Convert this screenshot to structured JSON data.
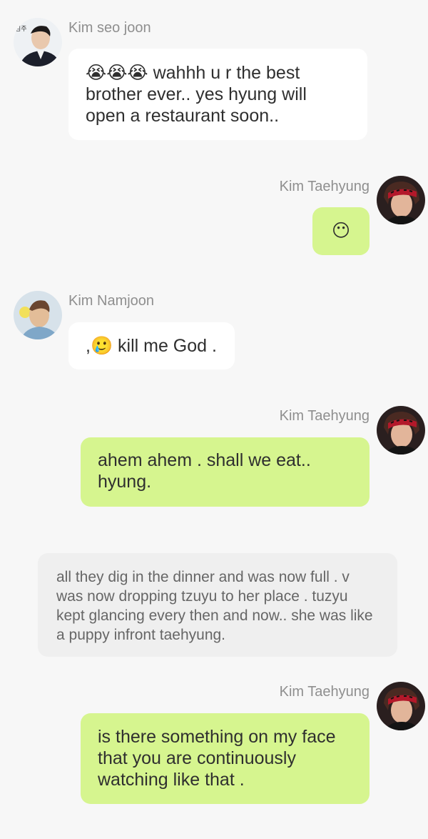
{
  "messages": [
    {
      "sender": "Kim seo joon",
      "text": "😭😭😭 wahhh u r the best brother ever.. yes hyung will open a restaurant soon..",
      "side": "left"
    },
    {
      "sender": "Kim Taehyung",
      "text": "😶",
      "side": "right"
    },
    {
      "sender": "Kim Namjoon",
      "text": ",🥲 kill me God .",
      "side": "left"
    },
    {
      "sender": "Kim Taehyung",
      "text": "ahem ahem . shall we eat.. hyung.",
      "side": "right"
    },
    {
      "sender": "Kim Taehyung",
      "text": "is there something on my face that you are continuously watching like that .",
      "side": "right"
    }
  ],
  "narration": "all they dig in the dinner and was now full . v was now dropping tzuyu to her place . tuzyu kept glancing every then and now.. she was like a puppy infront taehyung.",
  "avatar_logo_text": "김주",
  "colors": {
    "background": "#f7f7f7",
    "left_bubble": "#ffffff",
    "right_bubble": "#d6f58f",
    "narration_bg": "#efefef",
    "name_text": "#8f8f8f"
  }
}
